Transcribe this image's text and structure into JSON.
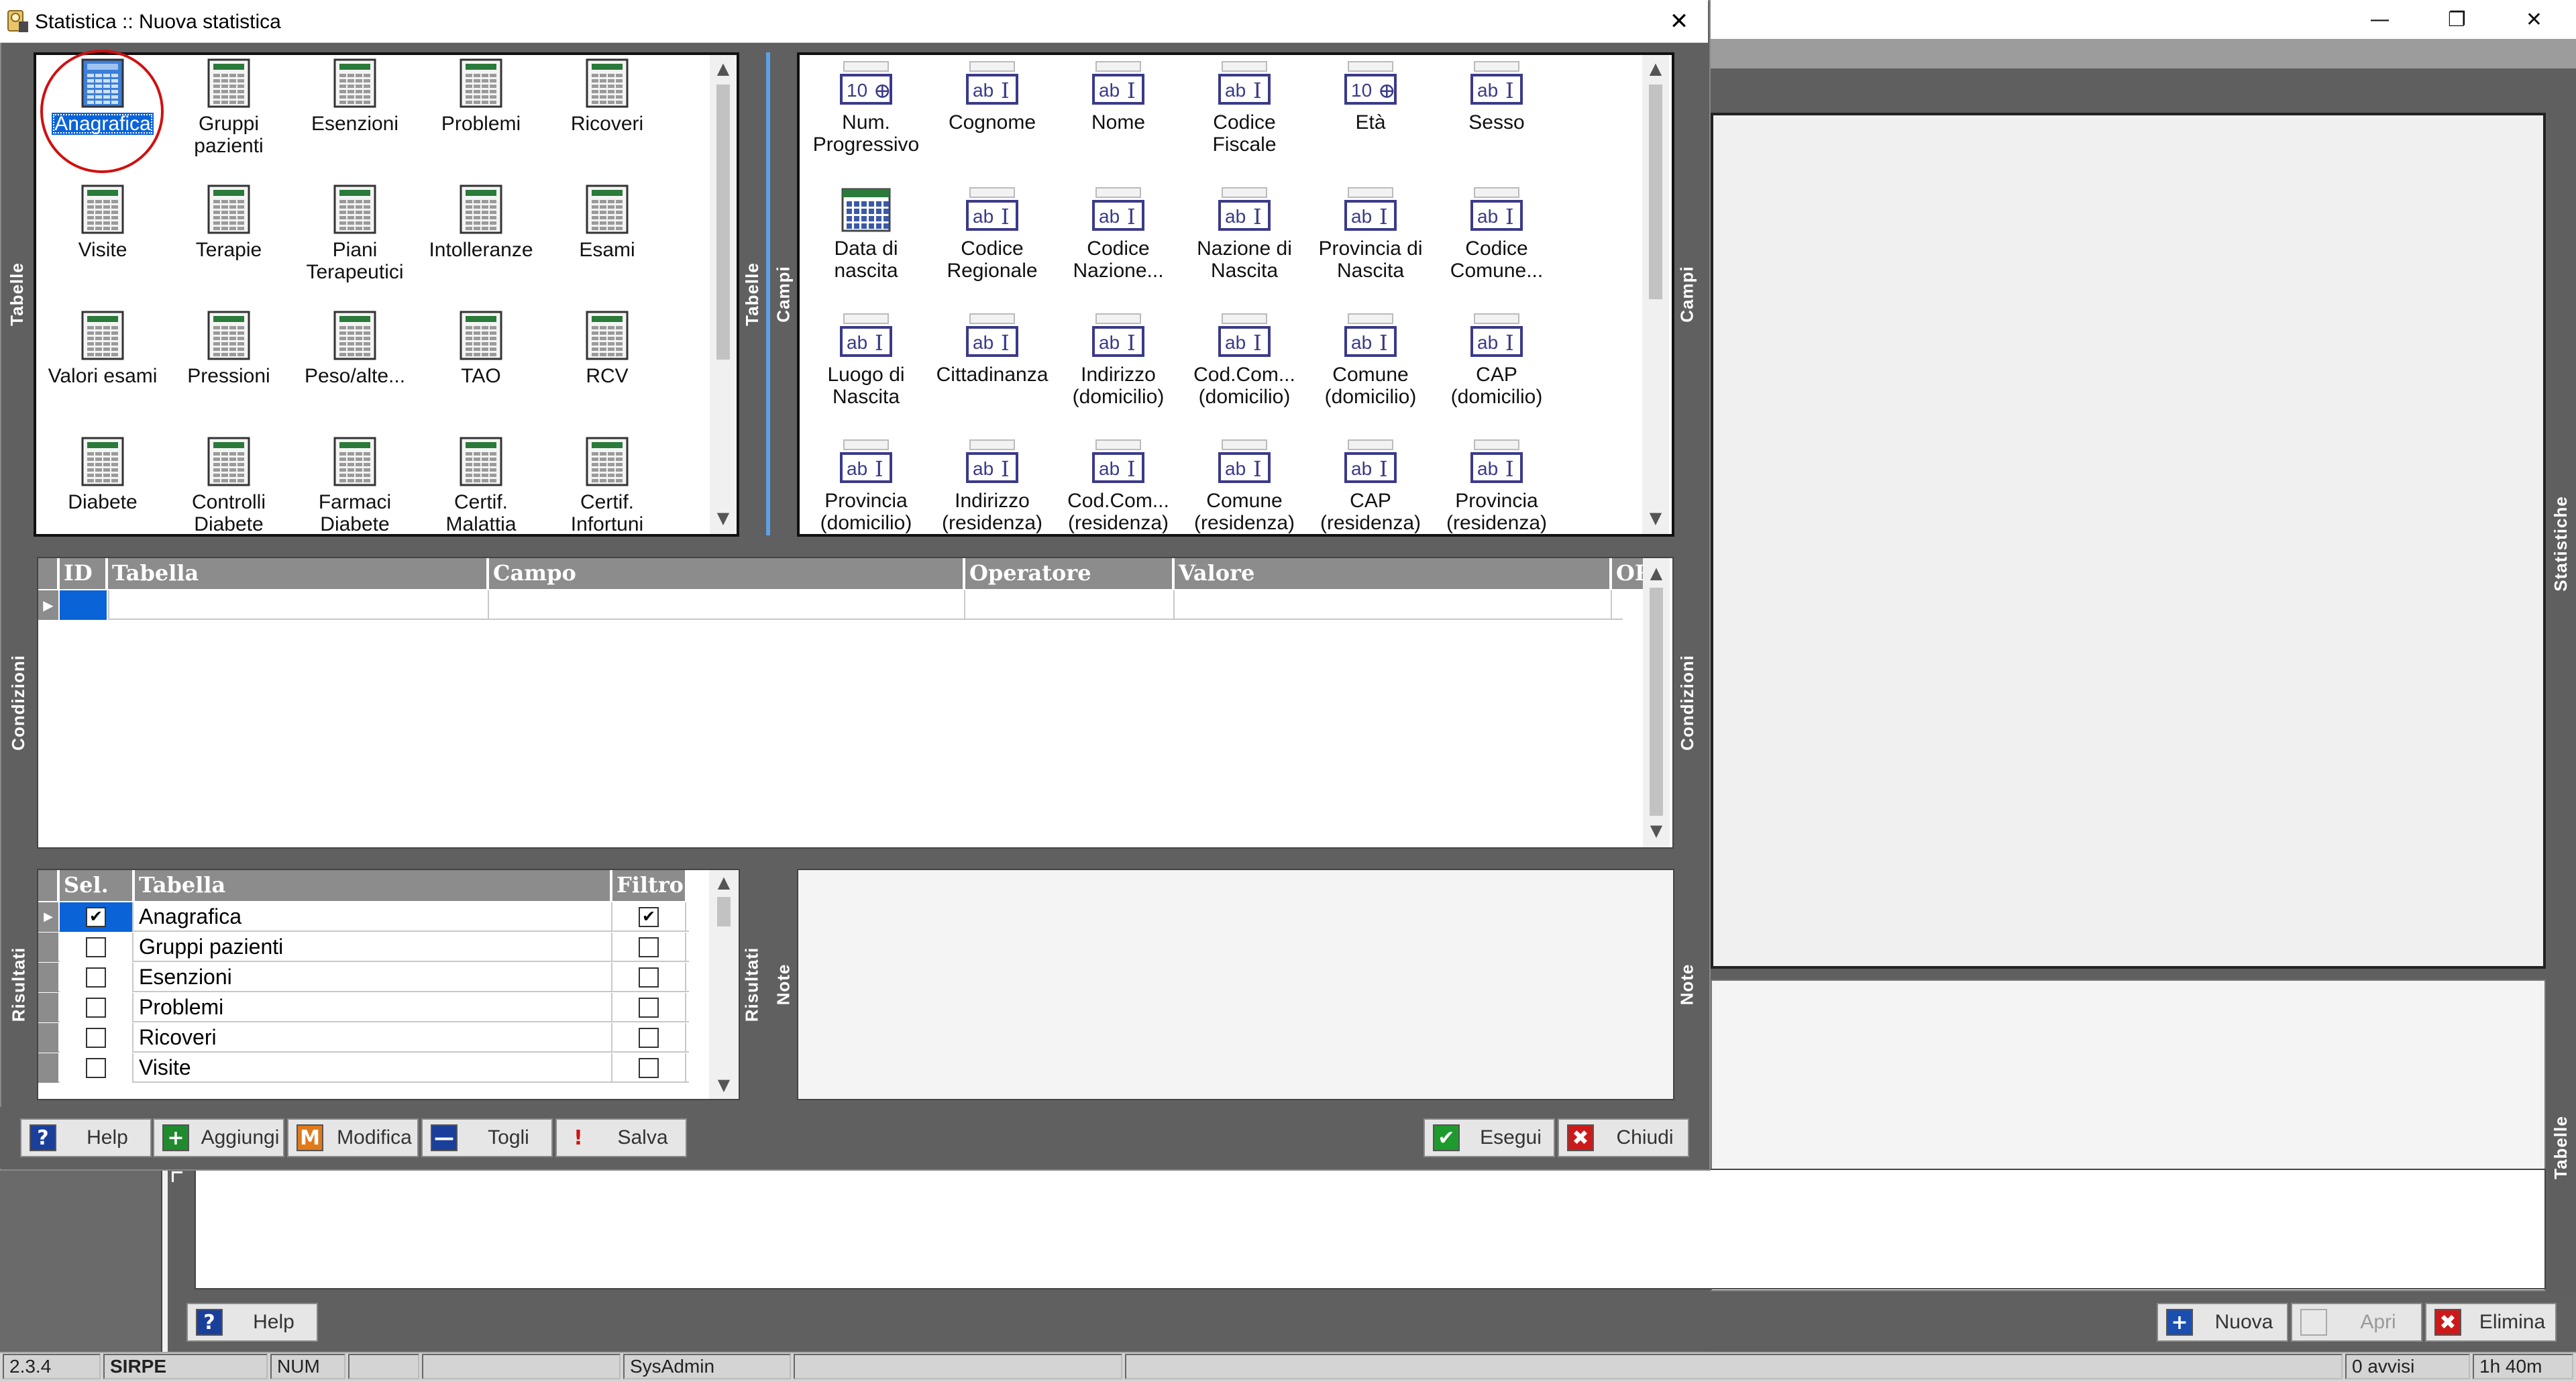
{
  "main_window": {
    "controls": {
      "minimize": "—",
      "restore": "❐",
      "close": "✕"
    },
    "side_tab_statistiche": "Statistiche",
    "side_tab_tabelle": "Tabelle",
    "buttons": {
      "help": "Help",
      "nuova": "Nuova",
      "apri": "Apri",
      "elimina": "Elimina"
    }
  },
  "status_bar": {
    "version": "2.3.4",
    "app": "SIRPE",
    "num": "NUM",
    "user": "SysAdmin",
    "avvisi": "0 avvisi",
    "time": "1h 40m"
  },
  "dialog": {
    "title": "Statistica :: Nuova statistica",
    "close": "✕",
    "side_tabs": {
      "tabelle": "Tabelle",
      "campi": "Campi",
      "condizioni": "Condizioni",
      "risultati": "Risultati",
      "note": "Note"
    },
    "tables": [
      {
        "label": "Anagrafica",
        "selected": true
      },
      {
        "label": "Gruppi pazienti"
      },
      {
        "label": "Esenzioni"
      },
      {
        "label": "Problemi"
      },
      {
        "label": "Ricoveri"
      },
      {
        "label": "Visite"
      },
      {
        "label": "Terapie"
      },
      {
        "label": "Piani Terapeutici"
      },
      {
        "label": "Intolleranze"
      },
      {
        "label": "Esami"
      },
      {
        "label": "Valori esami"
      },
      {
        "label": "Pressioni"
      },
      {
        "label": "Peso/alte..."
      },
      {
        "label": "TAO"
      },
      {
        "label": "RCV"
      },
      {
        "label": "Diabete"
      },
      {
        "label": "Controlli Diabete"
      },
      {
        "label": "Farmaci Diabete"
      },
      {
        "label": "Certif. Malattia"
      },
      {
        "label": "Certif. Infortuni"
      }
    ],
    "fields": [
      {
        "label": "Num. Progressivo",
        "type": "num"
      },
      {
        "label": "Cognome",
        "type": "text"
      },
      {
        "label": "Nome",
        "type": "text"
      },
      {
        "label": "Codice Fiscale",
        "type": "text"
      },
      {
        "label": "Età",
        "type": "num"
      },
      {
        "label": "Sesso",
        "type": "text"
      },
      {
        "label": "Data di nascita",
        "type": "date"
      },
      {
        "label": "Codice Regionale",
        "type": "text"
      },
      {
        "label": "Codice Nazione...",
        "type": "text"
      },
      {
        "label": "Nazione di Nascita",
        "type": "text"
      },
      {
        "label": "Provincia di Nascita",
        "type": "text"
      },
      {
        "label": "Codice Comune...",
        "type": "text"
      },
      {
        "label": "Luogo di Nascita",
        "type": "text"
      },
      {
        "label": "Cittadinanza",
        "type": "text"
      },
      {
        "label": "Indirizzo (domicilio)",
        "type": "text"
      },
      {
        "label": "Cod.Com... (domicilio)",
        "type": "text"
      },
      {
        "label": "Comune (domicilio)",
        "type": "text"
      },
      {
        "label": "CAP (domicilio)",
        "type": "text"
      },
      {
        "label": "Provincia (domicilio)",
        "type": "text"
      },
      {
        "label": "Indirizzo (residenza)",
        "type": "text"
      },
      {
        "label": "Cod.Com... (residenza)",
        "type": "text"
      },
      {
        "label": "Comune (residenza)",
        "type": "text"
      },
      {
        "label": "CAP (residenza)",
        "type": "text"
      },
      {
        "label": "Provincia (residenza)",
        "type": "text"
      }
    ],
    "icon_text": {
      "num": "10",
      "text": "ab",
      "cursor": "I"
    },
    "conditions_columns": [
      "ID",
      "Tabella",
      "Campo",
      "Operatore",
      "Valore",
      "OR"
    ],
    "results_columns": {
      "sel": "Sel.",
      "tabella": "Tabella",
      "filtro": "Filtro"
    },
    "results": [
      {
        "tabella": "Anagrafica",
        "sel": true,
        "filtro": true
      },
      {
        "tabella": "Gruppi pazienti",
        "sel": false,
        "filtro": false
      },
      {
        "tabella": "Esenzioni",
        "sel": false,
        "filtro": false
      },
      {
        "tabella": "Problemi",
        "sel": false,
        "filtro": false
      },
      {
        "tabella": "Ricoveri",
        "sel": false,
        "filtro": false
      },
      {
        "tabella": "Visite",
        "sel": false,
        "filtro": false
      }
    ],
    "buttons": {
      "help": "Help",
      "aggiungi": "Aggiungi",
      "modifica": "Modifica",
      "togli": "Togli",
      "salva": "Salva",
      "esegui": "Esegui",
      "chiudi": "Chiudi"
    },
    "button_icons": {
      "help": "?",
      "aggiungi": "+",
      "modifica": "M",
      "togli": "—",
      "salva": "!",
      "esegui": "✔",
      "chiudi": "✖"
    },
    "colors": {
      "selection": "#0a64d8",
      "highlight_circle": "#d01010",
      "icon_blue": "#3a3a8a"
    }
  }
}
